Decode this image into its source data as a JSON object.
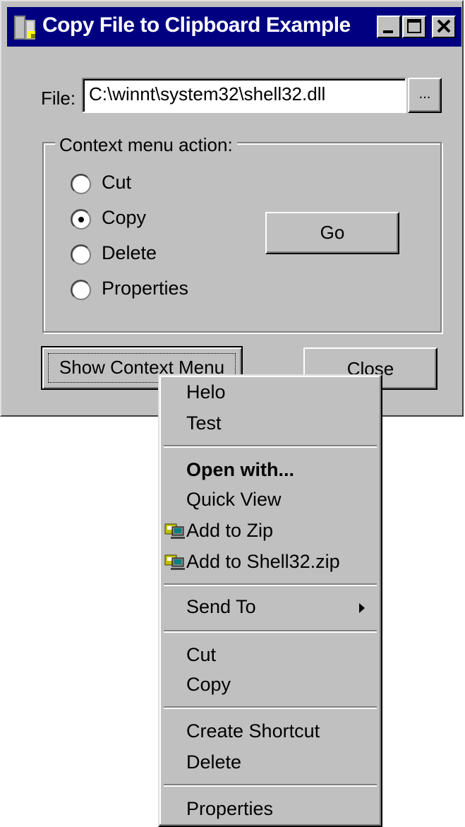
{
  "window": {
    "title": "Copy File to Clipboard Example"
  },
  "file": {
    "label": "File:",
    "value": "C:\\winnt\\system32\\shell32.dll",
    "browse_label": "..."
  },
  "group": {
    "legend": "Context menu action:",
    "options": [
      {
        "label": "Cut",
        "checked": false
      },
      {
        "label": "Copy",
        "checked": true
      },
      {
        "label": "Delete",
        "checked": false
      },
      {
        "label": "Properties",
        "checked": false
      }
    ],
    "go_label": "Go"
  },
  "buttons": {
    "show_context_menu": "Show Context Menu",
    "close": "Close"
  },
  "context_menu": {
    "items": [
      {
        "label": "Helo"
      },
      {
        "label": "Test"
      },
      {
        "label": "Open with..."
      },
      {
        "label": "Quick View"
      },
      {
        "label": "Add to Zip",
        "icon": "winzip-icon"
      },
      {
        "label": "Add to Shell32.zip",
        "icon": "winzip-icon"
      },
      {
        "label": "Send To",
        "submenu": true
      },
      {
        "label": "Cut"
      },
      {
        "label": "Copy"
      },
      {
        "label": "Create Shortcut"
      },
      {
        "label": "Delete"
      },
      {
        "label": "Properties"
      }
    ]
  },
  "colors": {
    "titlebar": "#000080",
    "face": "#c0c0c0"
  }
}
